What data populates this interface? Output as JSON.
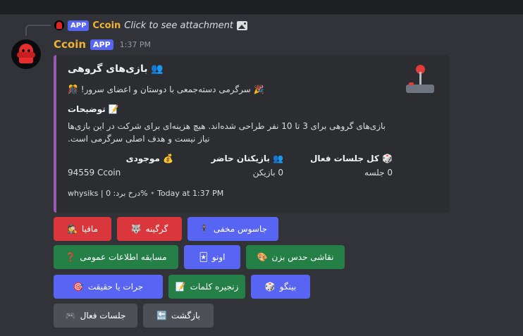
{
  "reply": {
    "tag": "APP",
    "name": "Ccoin",
    "text": "Click to see attachment"
  },
  "message": {
    "author": "Ccoin",
    "tag": "APP",
    "time": "1:37 PM"
  },
  "embed": {
    "accent_color": "#9b59b6",
    "title": "👥 بازی‌های گروهی",
    "line1": "🎉 سرگرمی دسته‌جمعی با دوستان و اعضای سرور! 🎊",
    "desc_heading": "📝 توضیحات",
    "description": "بازی‌های گروهی برای 3 تا 10 نفر طراحی شده‌اند. هیچ هزینه‌ای برای شرکت در این بازی‌ها نیاز نیست و هدف اصلی سرگرمی است.",
    "fields": [
      {
        "name": "💰 موجودی",
        "value": "94559 Ccoin"
      },
      {
        "name": "👥 بازیکنان حاضر",
        "value": "0 بازیکن"
      },
      {
        "name": "🎲 کل جلسات فعال",
        "value": "0 جلسه"
      }
    ],
    "footer_text": "whysiks | 0 :درخ برد%",
    "footer_time": "Today at 1:37 PM",
    "thumbnail_icon": "joystick-icon"
  },
  "buttons": {
    "row1": [
      {
        "label": "مافیا",
        "emoji": "🕵️",
        "style": "danger"
      },
      {
        "label": "گرگینه",
        "emoji": "🐺",
        "style": "danger"
      },
      {
        "label": "جاسوس مخفی",
        "emoji": "🕴️",
        "style": "primary"
      }
    ],
    "row2": [
      {
        "label": "مسابقه اطلاعات عمومی",
        "emoji": "❓",
        "style": "success"
      },
      {
        "label": "اونو",
        "emoji": "🃏",
        "style": "primary"
      },
      {
        "label": "نقاشی حدس بزن",
        "emoji": "🎨",
        "style": "success"
      }
    ],
    "row3": [
      {
        "label": "جرات یا حقیقت",
        "emoji": "🎯",
        "style": "primary"
      },
      {
        "label": "زنجیره کلمات",
        "emoji": "📝",
        "style": "success"
      },
      {
        "label": "بینگو",
        "emoji": "🎲",
        "style": "primary"
      }
    ],
    "row4": [
      {
        "label": "جلسات فعال",
        "emoji": "🎮",
        "style": "secondary"
      },
      {
        "label": "بازگشت",
        "emoji": "🔙",
        "style": "secondary"
      }
    ]
  }
}
